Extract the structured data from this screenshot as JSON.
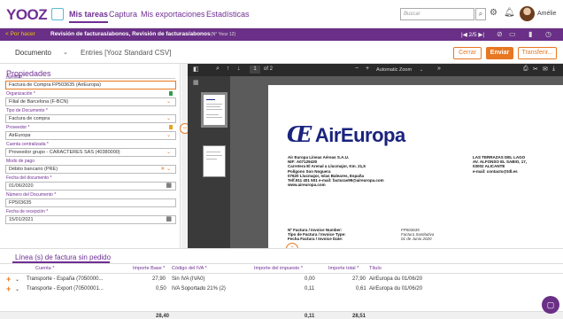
{
  "app": {
    "logo": "YOOZ"
  },
  "nav": {
    "tabs": [
      "Mis tareas",
      "Captura",
      "Mis exportaciones",
      "Estadísticas"
    ],
    "search_placeholder": "Buscar",
    "user": "Amélie",
    "icons": [
      "search-icon",
      "gear-icon",
      "bell-icon"
    ]
  },
  "bar": {
    "back": "< Por hacer",
    "breadcrumb": "Revisión de facturas/abonos, Revisión de facturas/abonos",
    "sub": "(N° Yooz 12)",
    "pager": "|◀  2/5  ▶|"
  },
  "doctabs": {
    "document": "Documento",
    "entries": "Entries [Yooz Standard CSV]"
  },
  "buttons": {
    "cerrar": "Cerrar",
    "enviar": "Enviar",
    "transfer": "Transferir..."
  },
  "form": {
    "title": "Propiedades",
    "fields": [
      {
        "label": "Apellido *",
        "value": "Factura de Compra FP503635 (AirEuropa)"
      },
      {
        "label": "Organización *",
        "value": "Filial de Barcelona (F-BCN)"
      },
      {
        "label": "Tipo de Documento *",
        "value": "Factura de compra"
      },
      {
        "label": "Proveedor *",
        "value": "AirEuropa"
      },
      {
        "label": "Cuenta centralizada *",
        "value": "Proveedor grupo - CARACTERES SAS (40380000)"
      },
      {
        "label": "Modo de pago",
        "value": "Débito bancario (PRE)"
      },
      {
        "label": "Fecha del documento *",
        "value": "01/06/2020"
      },
      {
        "label": "Número del Documento *",
        "value": "FP503635"
      },
      {
        "label": "Fecha de recepción *",
        "value": "15/01/2021"
      }
    ]
  },
  "pdf": {
    "page_of": "of 2",
    "page_num": "1",
    "zoom": "Automatic Zoom",
    "logo_text": "AirEuropa",
    "sender": "Air Europa Líneas Aéreas S.A.U.\nNIF: A07129430\nCarretera El Arenal a Llucmajor, Km. 21,5\nPolígono Son Noguera\n07620 Llucmajor, Islas Baleares, España\nTelf.911 401 501 e-mail: facturas99@aireuropa.com\nwww.aireuropa.com",
    "recipient": "LAS TERRAZAS DEL LAGO\nAV. ALFONSO EL SABIO, 17,\n03002 ALICANTE\ne-mail: contacto@tdl.es",
    "inv_labels": "Nº Factura / Invoice Number:\nTipo de Factura / Invoice Type:\nFecha Factura / Invoice Date:",
    "inv_values": "FP503635\nFactura Sustitutiva\n01 de Junio 2020"
  },
  "lines": {
    "title": "Línea (s) de factura sin pedido",
    "headers": [
      "Cuenta *",
      "Importe Base *",
      "Código del IVA *",
      "Importe del impuesto *",
      "Importe total *",
      "Título"
    ],
    "rows": [
      [
        "Transporte - España (7050000...",
        "27,90",
        "Sin IVA (IVA0)",
        "0,00",
        "27,90",
        "AirEuropa du 01/06/20"
      ],
      [
        "Transporte - Export (70500001...",
        "0,50",
        "IVA Soportado 21% (2)",
        "0,11",
        "0,61",
        "AirEuropa du 01/06/20"
      ]
    ],
    "totals": [
      "28,40",
      "0,11",
      "28,51"
    ]
  }
}
